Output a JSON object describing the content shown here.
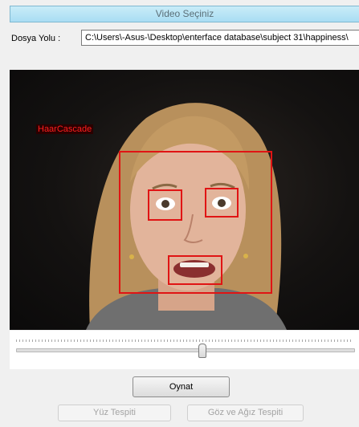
{
  "header": {
    "title": "Video Seçiniz"
  },
  "file_path": {
    "label": "Dosya Yolu :",
    "value": "C:\\Users\\-Asus-\\Desktop\\enterface database\\subject 31\\happiness\\"
  },
  "video": {
    "cascade_label": "HaarCascade",
    "frame_description": "woman's face with red detection boxes"
  },
  "slider": {
    "value_fraction": 0.55
  },
  "buttons": {
    "play": "Oynat",
    "face_detect": "Yüz Tespiti",
    "eye_mouth_detect": "Göz ve Ağız Tespiti"
  },
  "colors": {
    "detection_box": "#e01414",
    "title_bar": "#a9ddf3"
  }
}
